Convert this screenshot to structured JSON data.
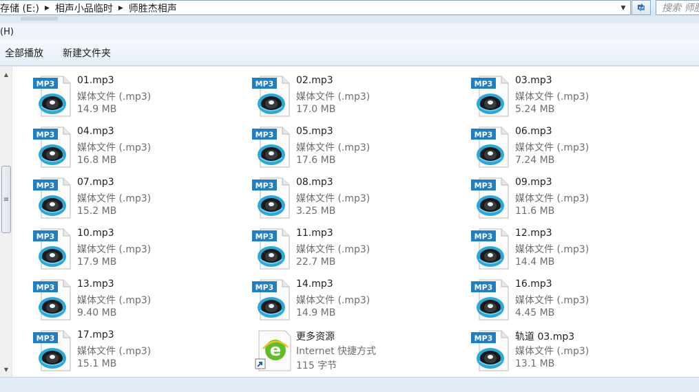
{
  "address_bar": {
    "crumbs": [
      "存储 (E:)",
      "相声小品临时",
      "师胜杰相声"
    ],
    "search_placeholder": "搜索 师胜杰相声"
  },
  "menu": {
    "help_label": "(H)"
  },
  "toolbar": {
    "play_all_label": "全部播放",
    "new_folder_label": "新建文件夹"
  },
  "files": [
    {
      "name": "01.mp3",
      "type": "媒体文件 (.mp3)",
      "size": "14.9 MB",
      "icon": "mp3-icon"
    },
    {
      "name": "02.mp3",
      "type": "媒体文件 (.mp3)",
      "size": "17.0 MB",
      "icon": "mp3-icon"
    },
    {
      "name": "03.mp3",
      "type": "媒体文件 (.mp3)",
      "size": "5.24 MB",
      "icon": "mp3-icon"
    },
    {
      "name": "04.mp3",
      "type": "媒体文件 (.mp3)",
      "size": "16.8 MB",
      "icon": "mp3-icon"
    },
    {
      "name": "05.mp3",
      "type": "媒体文件 (.mp3)",
      "size": "17.6 MB",
      "icon": "mp3-icon"
    },
    {
      "name": "06.mp3",
      "type": "媒体文件 (.mp3)",
      "size": "7.24 MB",
      "icon": "mp3-icon"
    },
    {
      "name": "07.mp3",
      "type": "媒体文件 (.mp3)",
      "size": "15.2 MB",
      "icon": "mp3-icon"
    },
    {
      "name": "08.mp3",
      "type": "媒体文件 (.mp3)",
      "size": "3.25 MB",
      "icon": "mp3-icon"
    },
    {
      "name": "09.mp3",
      "type": "媒体文件 (.mp3)",
      "size": "11.6 MB",
      "icon": "mp3-icon"
    },
    {
      "name": "10.mp3",
      "type": "媒体文件 (.mp3)",
      "size": "17.9 MB",
      "icon": "mp3-icon"
    },
    {
      "name": "11.mp3",
      "type": "媒体文件 (.mp3)",
      "size": "22.7 MB",
      "icon": "mp3-icon"
    },
    {
      "name": "12.mp3",
      "type": "媒体文件 (.mp3)",
      "size": "14.4 MB",
      "icon": "mp3-icon"
    },
    {
      "name": "13.mp3",
      "type": "媒体文件 (.mp3)",
      "size": "9.40 MB",
      "icon": "mp3-icon"
    },
    {
      "name": "14.mp3",
      "type": "媒体文件 (.mp3)",
      "size": "14.9 MB",
      "icon": "mp3-icon"
    },
    {
      "name": "16.mp3",
      "type": "媒体文件 (.mp3)",
      "size": "4.45 MB",
      "icon": "mp3-icon"
    },
    {
      "name": "17.mp3",
      "type": "媒体文件 (.mp3)",
      "size": "15.1 MB",
      "icon": "mp3-icon"
    },
    {
      "name": "更多资源",
      "type": "Internet 快捷方式",
      "size": "115 字节",
      "icon": "internet-shortcut-icon"
    },
    {
      "name": "轨道 03.mp3",
      "type": "媒体文件 (.mp3)",
      "size": "13.1 MB",
      "icon": "mp3-icon"
    }
  ],
  "colors": {
    "mp3_label_bg": "#1f7fc4",
    "disc_ring": "#2aa8d8",
    "ie_green": "#5fbf2a"
  }
}
